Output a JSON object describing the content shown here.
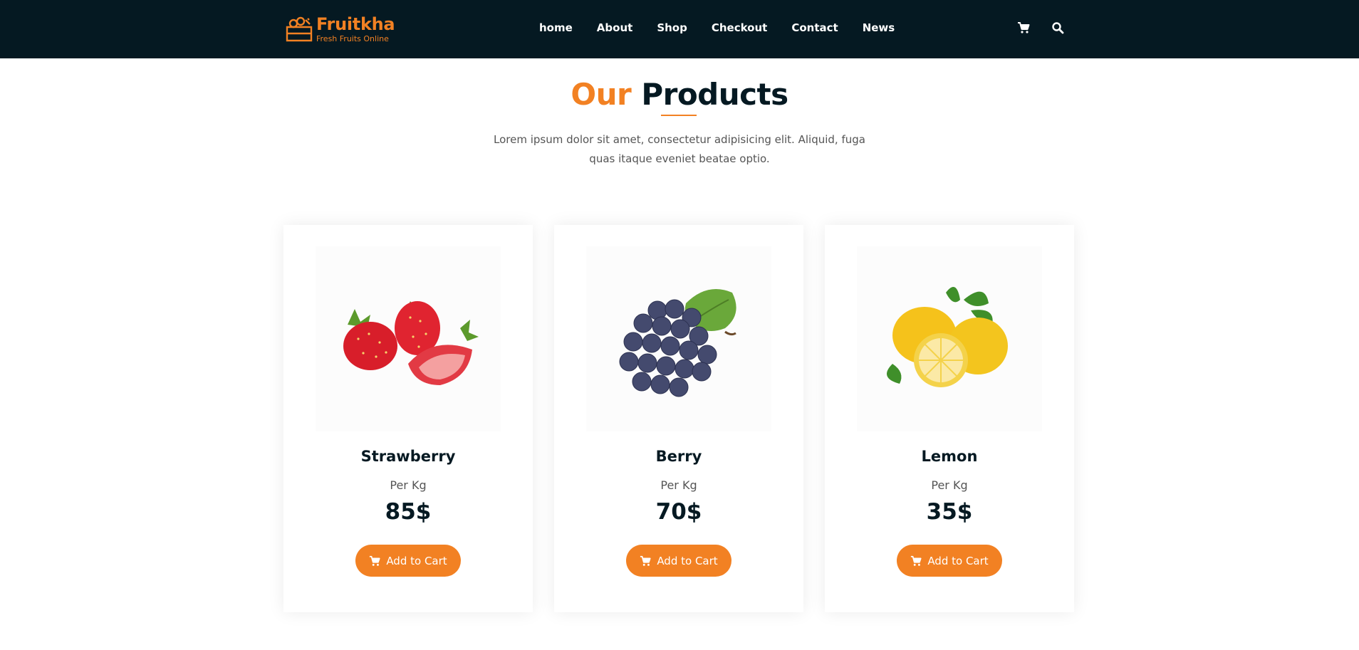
{
  "brand": {
    "name": "Fruitkha",
    "tagline": "Fresh Fruits Online",
    "accent_color": "#f28123",
    "dark_color": "#051922"
  },
  "nav": {
    "items": [
      {
        "label": "home"
      },
      {
        "label": "About"
      },
      {
        "label": "Shop"
      },
      {
        "label": "Checkout"
      },
      {
        "label": "Contact"
      },
      {
        "label": "News"
      }
    ],
    "icons": [
      "shopping-cart-icon",
      "search-icon"
    ]
  },
  "section": {
    "title_accent": "Our",
    "title_rest": "Products",
    "description": "Lorem ipsum dolor sit amet, consectetur adipisicing elit. Aliquid, fuga quas itaque eveniet beatae optio."
  },
  "products": [
    {
      "name": "Strawberry",
      "unit": "Per Kg",
      "price": "85$",
      "button_label": "Add to Cart",
      "image": "strawberry-image"
    },
    {
      "name": "Berry",
      "unit": "Per Kg",
      "price": "70$",
      "button_label": "Add to Cart",
      "image": "grapes-image"
    },
    {
      "name": "Lemon",
      "unit": "Per Kg",
      "price": "35$",
      "button_label": "Add to Cart",
      "image": "lemon-image"
    }
  ]
}
